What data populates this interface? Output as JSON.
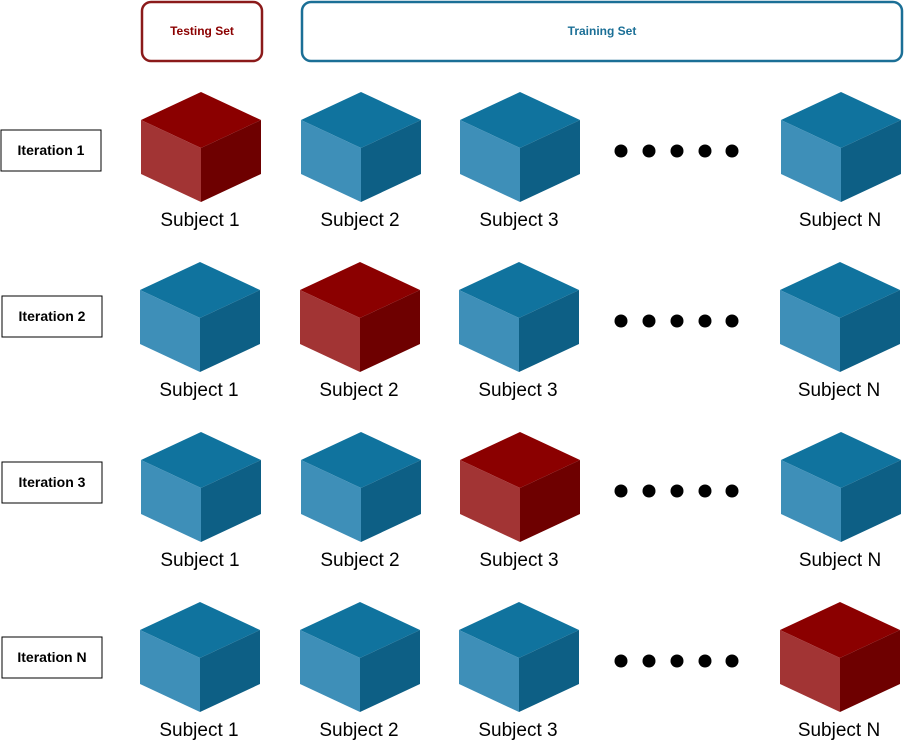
{
  "legend": {
    "testing_label": "Testing Set",
    "training_label": "Training Set"
  },
  "iterations": [
    {
      "label": "Iteration 1",
      "test_index": 0
    },
    {
      "label": "Iteration 2",
      "test_index": 1
    },
    {
      "label": "Iteration 3",
      "test_index": 2
    },
    {
      "label": "Iteration N",
      "test_index": 3
    }
  ],
  "subjects": [
    "Subject 1",
    "Subject 2",
    "Subject 3",
    "Subject N"
  ],
  "ellipsis_dot_count": 5,
  "colors": {
    "testing_border": "#8b1a1a",
    "testing_text": "#8b0000",
    "training_border": "#1b6f96",
    "training_text": "#1b6f96",
    "test_top": "#8b0000",
    "test_left": "#a23434",
    "test_right": "#6e0000",
    "train_top": "#10739e",
    "train_left": "#3e8fb8",
    "train_right": "#0d5f85"
  }
}
